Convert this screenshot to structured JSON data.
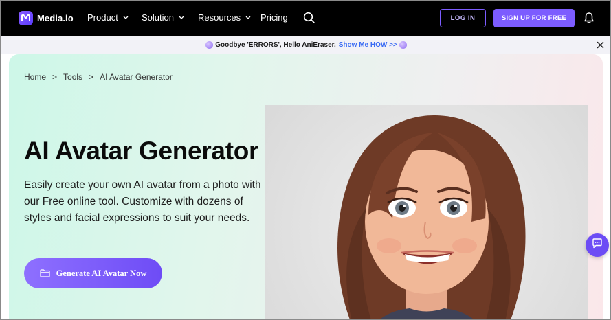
{
  "header": {
    "brand": "Media.io",
    "nav": [
      "Product",
      "Solution",
      "Resources",
      "Pricing"
    ],
    "login_label": "LOG IN",
    "signup_label": "SIGN UP FOR FREE",
    "icons": [
      "search-icon",
      "bell-icon"
    ]
  },
  "announcement": {
    "message": "Goodbye 'ERRORS', Hello AniEraser.",
    "link_label": "Show Me HOW >>",
    "link_color": "#3a6cf4"
  },
  "breadcrumb": [
    "Home",
    ">",
    "Tools",
    ">",
    "AI Avatar Generator"
  ],
  "hero": {
    "title": "AI Avatar Generator",
    "description": "Easily create your own AI avatar from a photo with our Free online tool. Customize with dozens of styles and facial expressions to suit your needs.",
    "cta_label": "Generate AI Avatar Now"
  },
  "colors": {
    "accent": "#7c5cff",
    "nav_bg": "#000000",
    "announce_bg": "#f2f2f7"
  }
}
